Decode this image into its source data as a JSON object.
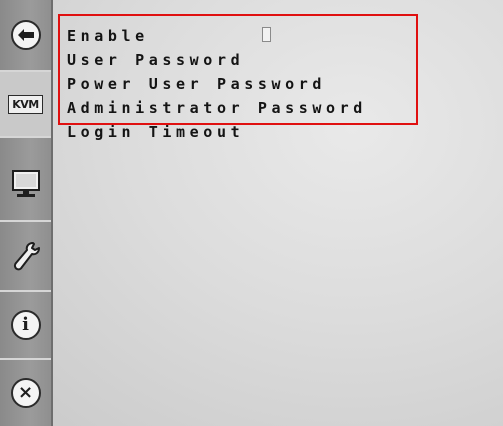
{
  "sidebar": {
    "items": [
      {
        "name": "back",
        "icon": "back-arrow-icon"
      },
      {
        "name": "kvm",
        "icon": "kvm-icon",
        "label": "KVM"
      },
      {
        "name": "monitor",
        "icon": "monitor-icon"
      },
      {
        "name": "tools",
        "icon": "wrench-icon"
      },
      {
        "name": "info",
        "icon": "info-icon",
        "label": "i"
      },
      {
        "name": "close",
        "icon": "close-icon",
        "label": "×"
      }
    ]
  },
  "menu": {
    "items": [
      {
        "label": "Enable"
      },
      {
        "label": "User Password"
      },
      {
        "label": "Power User Password"
      },
      {
        "label": "Administrator Password"
      },
      {
        "label": "Login Timeout"
      }
    ]
  },
  "colors": {
    "highlight": "#e01010"
  }
}
